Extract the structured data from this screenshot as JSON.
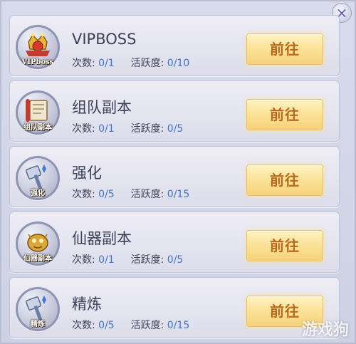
{
  "close_symbol": "×",
  "stat_labels": {
    "count": "次数:",
    "activity": "活跃度:"
  },
  "go_label": "前往",
  "watermark": "游戏狗",
  "tasks": [
    {
      "title": "VIPBOSS",
      "icon": "vip-boss-icon",
      "icon_label": "VIPboss",
      "count": "0/1",
      "activity": "0/10"
    },
    {
      "title": "组队副本",
      "icon": "team-dungeon-icon",
      "icon_label": "组队副本",
      "count": "0/1",
      "activity": "0/5"
    },
    {
      "title": "强化",
      "icon": "enhance-hammer-icon",
      "icon_label": "强化",
      "count": "0/5",
      "activity": "0/15"
    },
    {
      "title": "仙器副本",
      "icon": "artifact-dungeon-icon",
      "icon_label": "仙器副本",
      "count": "0/1",
      "activity": "0/5"
    },
    {
      "title": "精炼",
      "icon": "refine-hammer-icon",
      "icon_label": "精炼",
      "count": "0/5",
      "activity": "0/15"
    }
  ]
}
